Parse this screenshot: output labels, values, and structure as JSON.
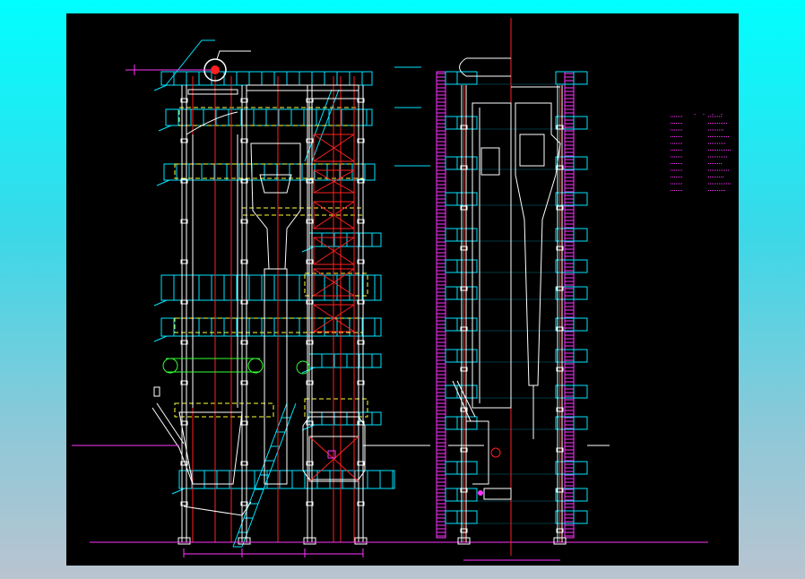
{
  "drawing": {
    "colors": {
      "background": "#000000",
      "structure": "#ffffff",
      "centerline": "#ff2020",
      "platform": "#00e5ff",
      "hidden": "#ffff33",
      "dimension": "#ff33ff",
      "aux": "#33ff33"
    }
  }
}
